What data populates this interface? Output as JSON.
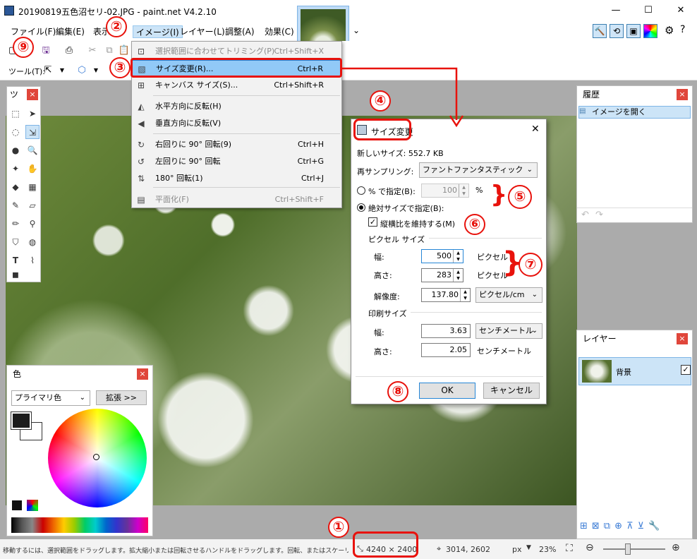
{
  "window": {
    "title": "20190819五色沼セリ-02.JPG - paint.net V4.2.10",
    "minimize": "—",
    "maximize": "☐",
    "close": "✕"
  },
  "menubar": {
    "items": [
      "ファイル(F)",
      "編集(E)",
      "表示",
      "イメージ(I)",
      "レイヤー(L)",
      "調整(A)",
      "効果(C)"
    ],
    "chevron": "⌄"
  },
  "toolbar": {
    "tool_label": "ツール(T):"
  },
  "image_menu": {
    "items": [
      {
        "label": "選択範囲に合わせてトリミング(P)",
        "shortcut": "Ctrl+Shift+X",
        "icon": "crop-icon",
        "disabled": true
      },
      {
        "label": "サイズ変更(R)...",
        "shortcut": "Ctrl+R",
        "icon": "resize-icon",
        "highlighted": true
      },
      {
        "label": "キャンバス サイズ(S)...",
        "shortcut": "Ctrl+Shift+R",
        "icon": "canvas-size-icon"
      },
      {
        "label": "水平方向に反転(H)",
        "shortcut": "",
        "icon": "flip-horizontal-icon"
      },
      {
        "label": "垂直方向に反転(V)",
        "shortcut": "",
        "icon": "flip-vertical-icon"
      },
      {
        "label": "右回りに 90° 回転(9)",
        "shortcut": "Ctrl+H",
        "icon": "rotate-cw-icon"
      },
      {
        "label": "左回りに 90° 回転",
        "shortcut": "Ctrl+G",
        "icon": "rotate-ccw-icon"
      },
      {
        "label": "180° 回転(1)",
        "shortcut": "Ctrl+J",
        "icon": "rotate-180-icon"
      },
      {
        "label": "平面化(F)",
        "shortcut": "Ctrl+Shift+F",
        "icon": "flatten-icon",
        "disabled": true
      }
    ]
  },
  "dialog": {
    "title": "サイズ変更",
    "close": "✕",
    "new_size": "新しいサイズ: 552.7 KB",
    "resample_label": "再サンプリング:",
    "resample_value": "ファントファンタスティック",
    "percent_label": "% で指定(B):",
    "percent_value": "100",
    "percent_unit": "%",
    "absolute_label": "絶対サイズで指定(B):",
    "keep_aspect": "縦横比を維持する(M)",
    "pixel_size": "ピクセル サイズ",
    "width_label": "幅:",
    "width_value": "500",
    "height_label": "高さ:",
    "height_value": "283",
    "pixel_unit": "ピクセル",
    "resolution_label": "解像度:",
    "resolution_value": "137.80",
    "resolution_unit": "ピクセル/cm",
    "print_size": "印刷サイズ",
    "print_width": "3.63",
    "print_height": "2.05",
    "cm_unit": "センチメートル",
    "ok": "OK",
    "cancel": "キャンセル"
  },
  "history": {
    "title": "履歴",
    "item": "イメージを開く"
  },
  "layers": {
    "title": "レイヤー",
    "layer_name": "背景"
  },
  "colors": {
    "title": "色",
    "mode": "プライマリ色",
    "expand": "拡張 >>",
    "primary": "#1c1c1c",
    "secondary": "#ffffff"
  },
  "tools_panel": {
    "title": "ツ"
  },
  "statusbar": {
    "hint": "移動するには、選択範囲をドラッグします。拡大縮小または回転させるハンドルをドラッグします。回転、またはスケーリングを制約するには、shift キーを押し。",
    "image_size": "4240 × 2400",
    "cursor": "3014, 2602",
    "unit": "px",
    "zoom": "23%"
  },
  "annotations": [
    "①",
    "②",
    "③",
    "④",
    "⑤",
    "⑥",
    "⑦",
    "⑧",
    "⑨"
  ],
  "accent": "#e8120c"
}
